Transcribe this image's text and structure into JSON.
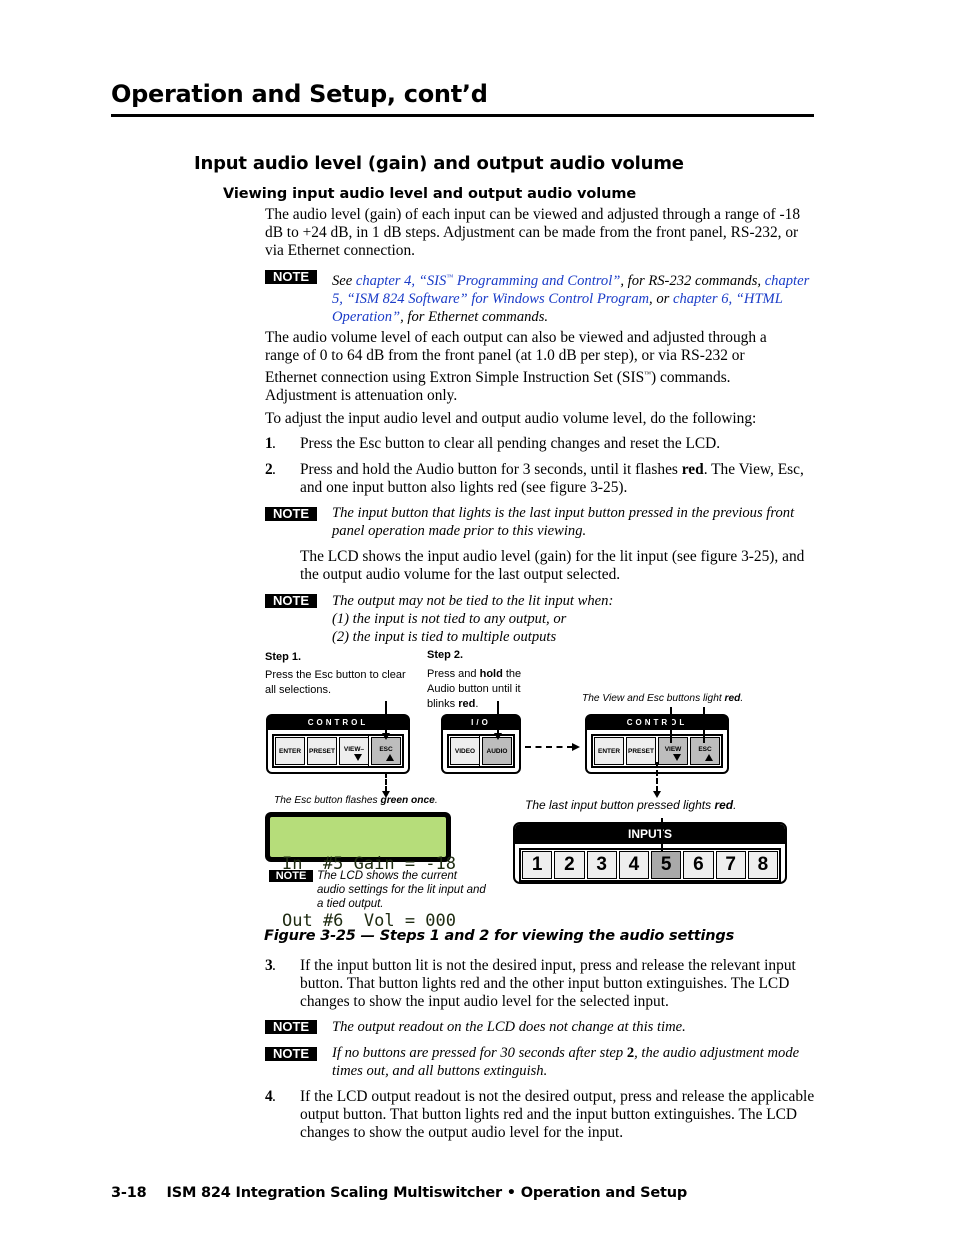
{
  "header": {
    "page_title": "Operation and Setup, cont’d"
  },
  "section": {
    "title": "Input audio level (gain) and output audio volume",
    "subsection_title": "Viewing input audio level and output audio volume"
  },
  "body": {
    "para1": "The audio level (gain) of each input can be viewed and adjusted through a range of -18 dB to +24 dB, in 1 dB steps.  Adjustment can be made from the front panel, RS-232, or via Ethernet connection.",
    "note1": {
      "badge": "NOTE",
      "see": "See ",
      "link1": "chapter 4, “SIS",
      "tm": "™",
      "link1b": " Programming and Control”",
      "mid1": ", for RS-232 commands, ",
      "link2": "chapter 5, “ISM 824 Software” for Windows Control Program",
      "mid2": ", or ",
      "link3": "chapter 6, “HTML Operation”",
      "end": ", for Ethernet commands."
    },
    "para2_a": "The audio volume level of each output can also be viewed and adjusted through a range of 0 to 64 dB from the front panel (at 1.0 dB per step), or via RS-232 or Ethernet connection using Extron Simple Instruction Set (SIS",
    "para2_tm": "™",
    "para2_b": ") commands.  Adjustment is attenuation only.",
    "para3": "To adjust the input audio level and output audio volume level, do the following:",
    "steps": [
      {
        "num": "1",
        "text": "Press the Esc button to clear all pending changes and reset the LCD."
      },
      {
        "num": "2",
        "text_a": "Press and hold the Audio button for 3 seconds, until it flashes ",
        "bold": "red",
        "text_b": ".  The View, Esc, and one input button also lights red (see figure 3-25)."
      }
    ],
    "note2": {
      "badge": "NOTE",
      "text": "The input button that lights is the last input button pressed in the previous front panel operation made prior to this viewing."
    },
    "para4": "The LCD shows the input audio level (gain) for the lit input (see figure 3-25), and the output audio volume for the last output selected.",
    "note3": {
      "badge": "NOTE",
      "lines": [
        "The output may not be tied to the lit input when:",
        "(1) the input is not tied to any output, or",
        "(2) the input is tied to multiple outputs"
      ]
    },
    "steps_b": [
      {
        "num": "3",
        "text": "If the input button lit is not the desired input, press and release the relevant input button.  That button lights red and the other input button extinguishes.  The LCD changes to show the input audio level for the selected input."
      },
      {
        "num": "4",
        "text": "If the LCD output readout is not the desired output, press and release the applicable output button.  That button lights red and the input button extinguishes.  The LCD changes to show the output audio level for the input."
      }
    ],
    "note4": {
      "badge": "NOTE",
      "text": "The output readout on the LCD does not change at this time."
    },
    "note5": {
      "badge": "NOTE",
      "text_a": "If no buttons are pressed for 30 seconds after step ",
      "bold": "2",
      "text_b": ", the audio adjustment mode times out, and all buttons extinguish."
    }
  },
  "figure": {
    "step1": {
      "heading": "Step 1.",
      "text": "Press the Esc button to clear all selections."
    },
    "step2": {
      "heading": "Step 2.",
      "text_a": "Press and ",
      "bold1": "hold",
      "text_b": " the Audio button until it blinks ",
      "bold2": "red",
      "text_c": "."
    },
    "view_esc_caption": {
      "text": "The View and Esc buttons light ",
      "bold": "red",
      "end": "."
    },
    "esc_flash_caption": {
      "text": "The Esc button flashes ",
      "bold": "green once",
      "end": "."
    },
    "last_input_caption": {
      "text": "The last input button pressed lights ",
      "bold": "red",
      "end": "."
    },
    "control_panel_1": {
      "title": "CONTROL",
      "buttons": [
        "ENTER",
        "PRESET",
        "VIEW–",
        "ESC"
      ]
    },
    "io_panel": {
      "title": "I/O",
      "buttons": [
        "VIDEO",
        "AUDIO"
      ]
    },
    "control_panel_2": {
      "title": "CONTROL",
      "buttons": [
        "ENTER",
        "PRESET",
        "VIEW",
        "ESC"
      ]
    },
    "lcd": {
      "line1": "In  #5 Gain = -18",
      "line2": "Out #6  Vol = 000"
    },
    "inputs_panel": {
      "title": "INPUTS",
      "buttons": [
        "1",
        "2",
        "3",
        "4",
        "5",
        "6",
        "7",
        "8"
      ],
      "lit": "5"
    },
    "lcd_note": {
      "badge": "NOTE",
      "text": "The LCD shows the current audio settings for the lit input and a tied output."
    },
    "caption": "Figure 3-25 — Steps 1 and 2 for viewing the audio settings"
  },
  "footer": {
    "page_number": "3-18",
    "text": "ISM 824 Integration Scaling Multiswitcher • Operation and Setup"
  }
}
